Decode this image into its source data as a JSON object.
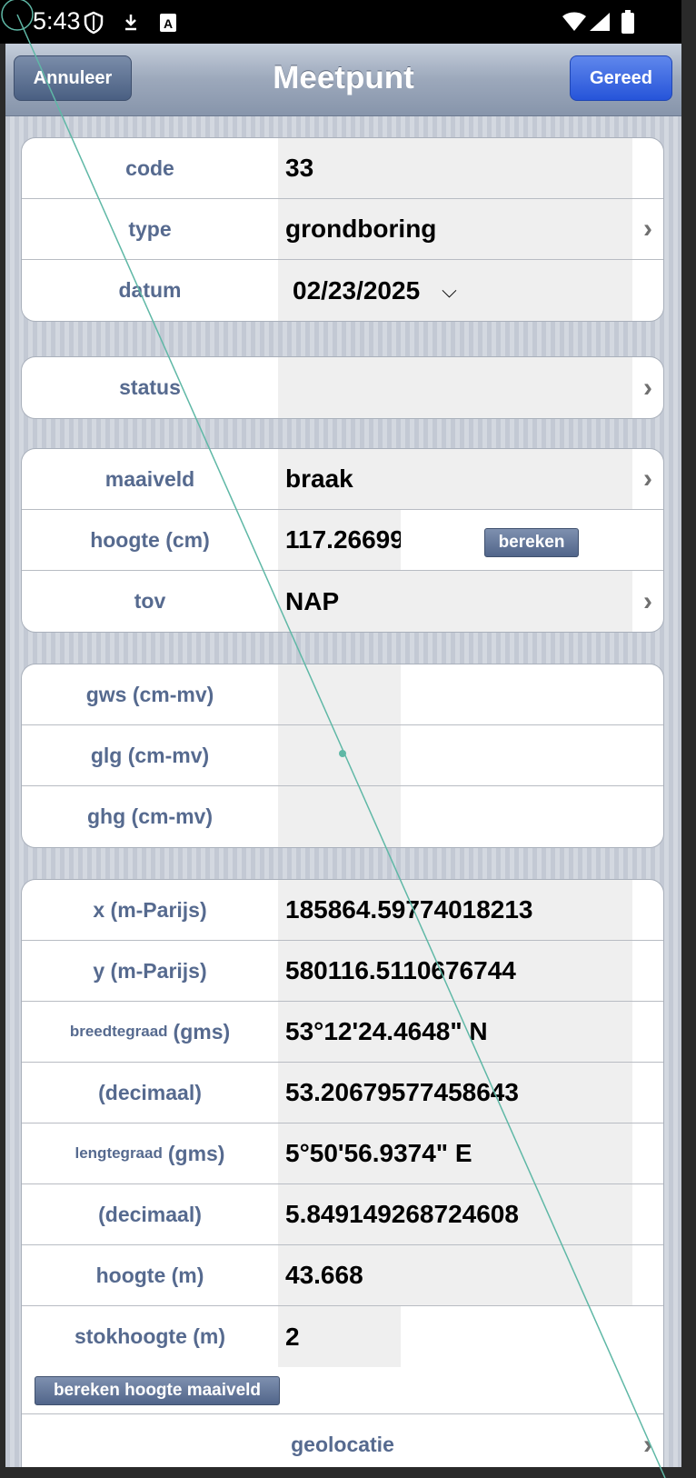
{
  "status_bar": {
    "time": "5:43"
  },
  "navbar": {
    "cancel": "Annuleer",
    "title": "Meetpunt",
    "done": "Gereed"
  },
  "group1": [
    {
      "label": "code",
      "value": "33"
    },
    {
      "label": "type",
      "value": "grondboring"
    },
    {
      "label": "datum",
      "value": "02/23/2025"
    }
  ],
  "group2": [
    {
      "label": "status",
      "value": ""
    }
  ],
  "group3": [
    {
      "label": "maaiveld",
      "value": "braak"
    },
    {
      "label": "hoogte (cm)",
      "value": "117.26699",
      "button": "bereken"
    },
    {
      "label": "tov",
      "value": "NAP"
    }
  ],
  "group4": [
    {
      "label": "gws (cm-mv)",
      "value": ""
    },
    {
      "label": "glg (cm-mv)",
      "value": ""
    },
    {
      "label": "ghg (cm-mv)",
      "value": ""
    }
  ],
  "group5": [
    {
      "label": "x (m-Parijs)",
      "value": "185864.59774018213"
    },
    {
      "label": "y (m-Parijs)",
      "value": "580116.5110676744"
    },
    {
      "label_small": "breedtegraad",
      "label": "(gms)",
      "value": "53°12'24.4648\" N"
    },
    {
      "label": "(decimaal)",
      "value": "53.20679577458643"
    },
    {
      "label_small": "lengtegraad",
      "label": "(gms)",
      "value": "5°50'56.9374\" E"
    },
    {
      "label": "(decimaal)",
      "value": "5.849149268724608"
    },
    {
      "label": "hoogte (m)",
      "value": "43.668"
    },
    {
      "label": "stokhoogte (m)",
      "value": "2"
    }
  ],
  "calc_ground_button": "bereken hoogte maaiveld",
  "geolocation_label": "geolocatie",
  "colors": {
    "label": "#566a8f",
    "done_button": "#2654d9",
    "cancel_button": "#4a5f82"
  }
}
